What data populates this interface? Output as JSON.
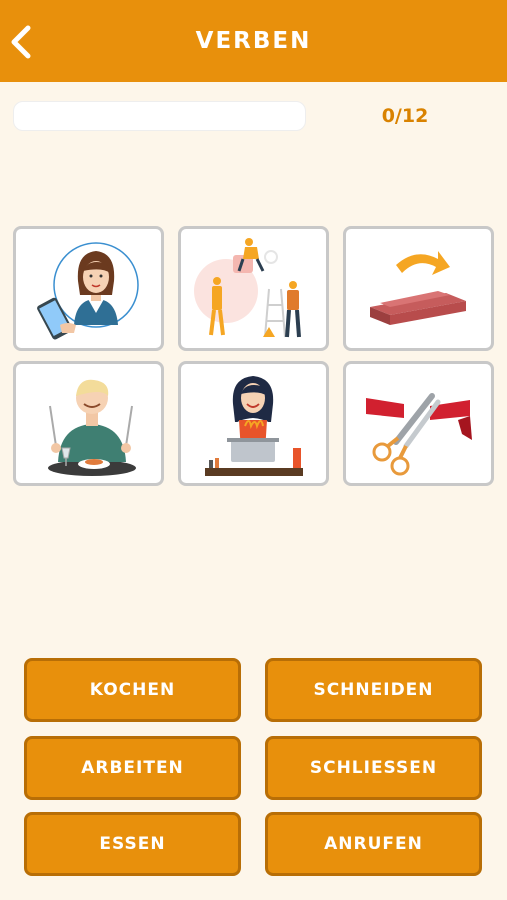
{
  "header": {
    "title": "VERBEN",
    "back_icon": "chevron-left-icon"
  },
  "progress": {
    "counter": "0/12",
    "fraction": 0
  },
  "cards": [
    {
      "icon": "phone-call-woman-icon"
    },
    {
      "icon": "construction-workers-icon"
    },
    {
      "icon": "closing-box-icon"
    },
    {
      "icon": "eating-man-icon"
    },
    {
      "icon": "cooking-woman-icon"
    },
    {
      "icon": "scissors-ribbon-icon"
    }
  ],
  "answers": [
    "KOCHEN",
    "SCHNEIDEN",
    "ARBEITEN",
    "SCHLIESSEN",
    "ESSEN",
    "ANRUFEN"
  ],
  "colors": {
    "accent": "#e8900c",
    "background": "#fdf6ea",
    "card_border": "#c8c8c8"
  }
}
